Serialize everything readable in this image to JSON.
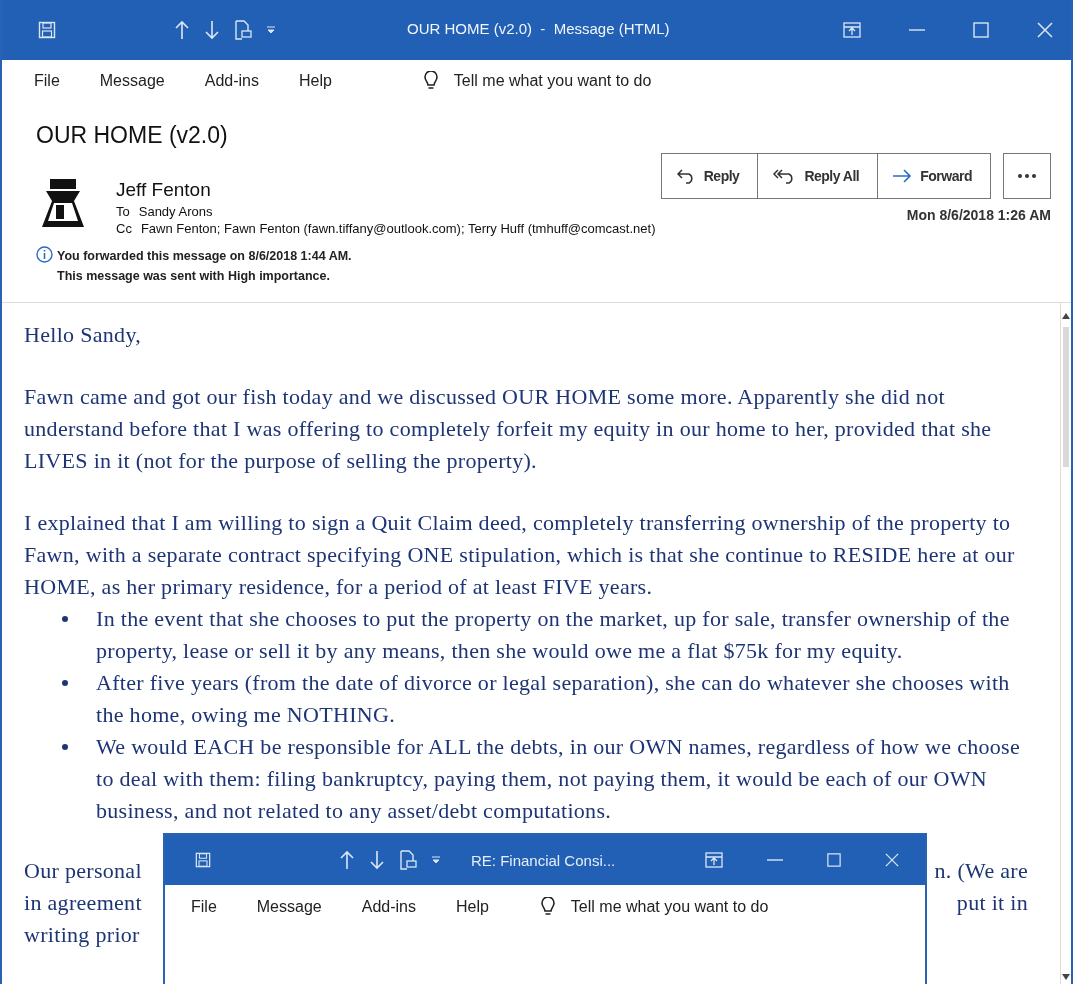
{
  "window": {
    "title": "OUR HOME (v2.0)  -  Message (HTML)"
  },
  "menu": [
    "File",
    "Message",
    "Add-ins",
    "Help"
  ],
  "tell_me": "Tell me what you want to do",
  "message": {
    "subject": "OUR HOME (v2.0)",
    "sender": "Jeff Fenton",
    "to_label": "To",
    "to": "Sandy Arons",
    "cc_label": "Cc",
    "cc": "Fawn Fenton; Fawn Fenton (fawn.tiffany@outlook.com); Terry Huff (tmhuff@comcast.net)",
    "date": "Mon 8/6/2018 1:26 AM",
    "info": [
      "You forwarded this message on 8/6/2018 1:44 AM.",
      "This message was sent with High importance."
    ]
  },
  "actions": [
    {
      "label": "Reply",
      "kind": "reply"
    },
    {
      "label": "Reply All",
      "kind": "reply-all"
    },
    {
      "label": "Forward",
      "kind": "forward"
    },
    {
      "kind": "more"
    }
  ],
  "body": {
    "greeting": "Hello Sandy,",
    "paragraphs": [
      "Fawn came and got our fish today and we discussed OUR HOME some more. Apparently she did not understand before that I was offering to completely forfeit my equity in our home to her, provided that she LIVES in it (not for the purpose of selling the property).",
      "I explained that I am willing to sign a Quit Claim deed, completely transferring ownership of the property to Fawn, with a separate contract specifying ONE stipulation, which is that she continue to RESIDE here at our HOME, as her primary residence, for a period of at least FIVE years."
    ],
    "bullets": [
      "In the event that she chooses to put the property on the market, up for sale, transfer ownership of the property, lease or sell it by any means, then she would owe me a flat $75k for my equity.",
      "After five years (from the date of divorce or legal separation), she can do whatever she chooses with the home, owing me NOTHING.",
      "We would EACH be responsible for ALL the debts, in our OWN names, regardless of how we choose to deal with them: filing bankruptcy, paying them, not paying them, it would be each of our OWN business, and not related to any asset/debt computations."
    ],
    "partial_lines": [
      {
        "left": "Our personal",
        "right": "n. (We are"
      },
      {
        "left": "in agreement",
        "right": "put it in"
      },
      {
        "left": "writing prior"
      }
    ]
  },
  "overlay_window": {
    "title": "RE: Financial Consi...",
    "menu": [
      "File",
      "Message",
      "Add-ins",
      "Help"
    ],
    "tell_me": "Tell me what you want to do"
  }
}
